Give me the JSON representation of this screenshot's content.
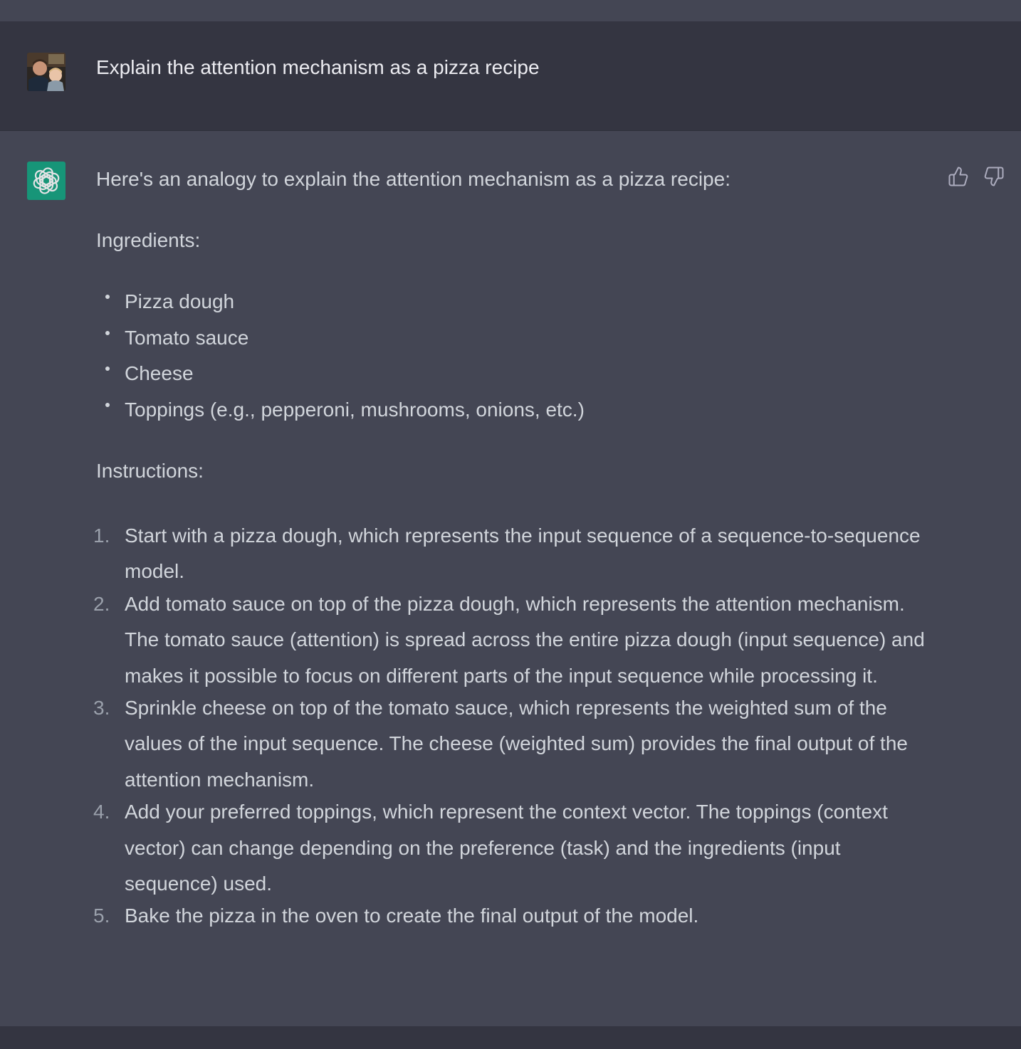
{
  "conversation": {
    "user_message": {
      "avatar": "user-photo",
      "text": "Explain the attention mechanism as a pizza recipe"
    },
    "assistant_message": {
      "avatar": "openai-logo-icon",
      "intro": "Here's an analogy to explain the attention mechanism as a pizza recipe:",
      "ingredients_heading": "Ingredients:",
      "ingredients": [
        "Pizza dough",
        "Tomato sauce",
        "Cheese",
        "Toppings (e.g., pepperoni, mushrooms, onions, etc.)"
      ],
      "instructions_heading": "Instructions:",
      "instructions": [
        {
          "num": "1.",
          "text": "Start with a pizza dough, which represents the input sequence of a sequence-to-sequence model."
        },
        {
          "num": "2.",
          "text": "Add tomato sauce on top of the pizza dough, which represents the attention mechanism. The tomato sauce (attention) is spread across the entire pizza dough (input sequence) and makes it possible to focus on different parts of the input sequence while processing it."
        },
        {
          "num": "3.",
          "text": "Sprinkle cheese on top of the tomato sauce, which represents the weighted sum of the values of the input sequence. The cheese (weighted sum) provides the final output of the attention mechanism."
        },
        {
          "num": "4.",
          "text": "Add your preferred toppings, which represent the context vector. The toppings (context vector) can change depending on the preference (task) and the ingredients (input sequence) used."
        },
        {
          "num": "5.",
          "text": "Bake the pizza in the oven to create the final output of the model."
        }
      ]
    },
    "feedback": {
      "thumbs_up_icon": "thumbs-up-icon",
      "thumbs_down_icon": "thumbs-down-icon"
    }
  },
  "colors": {
    "user_bg": "#343541",
    "assistant_bg": "#444654",
    "text": "#d1d5db",
    "brand": "#10a37f"
  }
}
